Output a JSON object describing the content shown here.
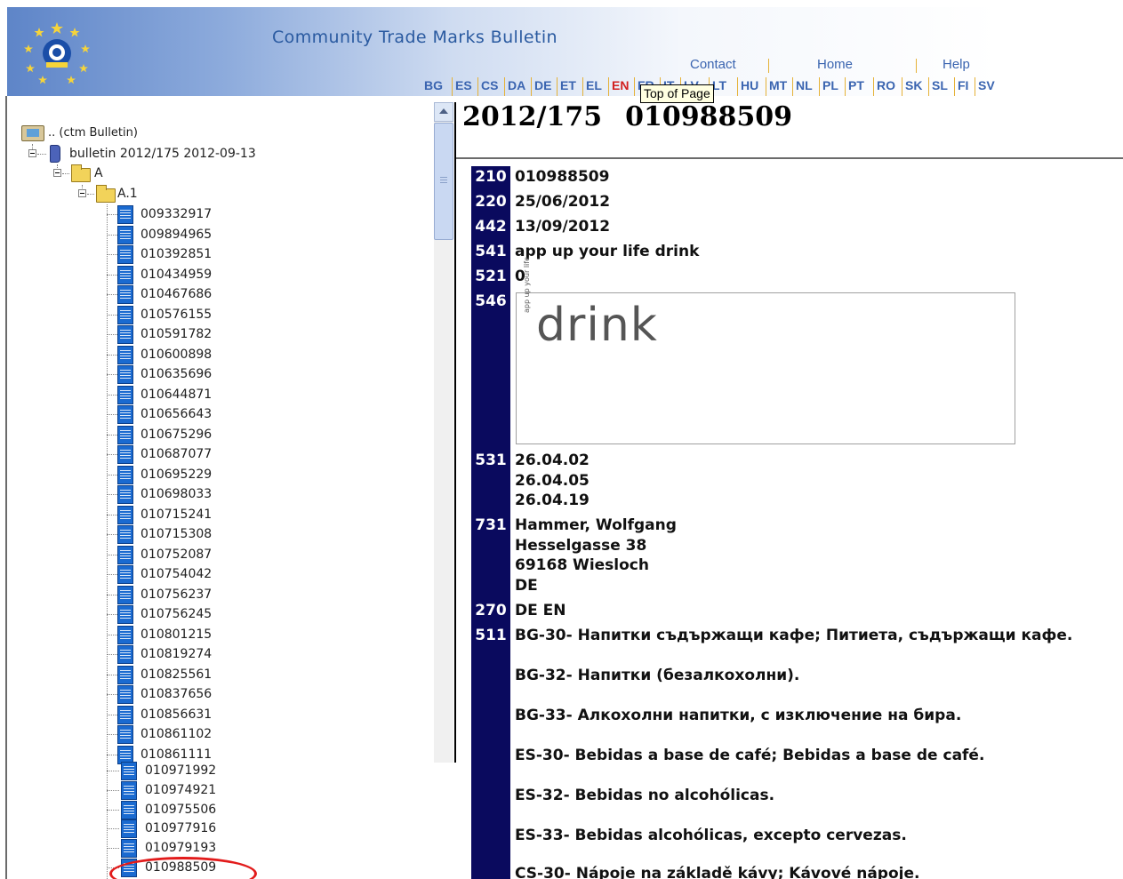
{
  "header": {
    "site_title": "Community Trade Marks Bulletin",
    "links": [
      "Contact",
      "Home",
      "Help"
    ],
    "languages": [
      "BG",
      "ES",
      "CS",
      "DA",
      "DE",
      "ET",
      "EL",
      "EN",
      "FR",
      "IT",
      "LV",
      "LT",
      "HU",
      "MT",
      "NL",
      "PL",
      "PT",
      "RO",
      "SK",
      "SL",
      "FI",
      "SV"
    ],
    "active_language": "EN",
    "tooltip": "Top of Page"
  },
  "tree": {
    "root_label": ".. (ctm Bulletin)",
    "bulletin_label": "bulletin 2012/175 2012-09-13",
    "folder_a": "A",
    "folder_a1": "A.1",
    "items": [
      "009332917",
      "009894965",
      "010392851",
      "010434959",
      "010467686",
      "010576155",
      "010591782",
      "010600898",
      "010635696",
      "010644871",
      "010656643",
      "010675296",
      "010687077",
      "010695229",
      "010698033",
      "010715241",
      "010715308",
      "010752087",
      "010754042",
      "010756237",
      "010756245",
      "010801215",
      "010819274",
      "010825561",
      "010837656",
      "010856631",
      "010861102",
      "010861111"
    ],
    "items_lower": [
      "010971992",
      "010974921",
      "010975506",
      "010977916",
      "010979193",
      "010988509"
    ],
    "highlighted_item": "010988509"
  },
  "record": {
    "issue": "2012/175",
    "number": "010988509",
    "f210": {
      "code": "210",
      "value": "010988509"
    },
    "f220": {
      "code": "220",
      "value": "25/06/2012"
    },
    "f442": {
      "code": "442",
      "value": "13/09/2012"
    },
    "f541": {
      "code": "541",
      "value": "app up your life drink"
    },
    "f521": {
      "code": "521",
      "value": "0"
    },
    "f546": {
      "code": "546",
      "mark_word": "drink",
      "mark_tag": "app up your life"
    },
    "f531": {
      "code": "531",
      "lines": [
        "26.04.02",
        "26.04.05",
        "26.04.19"
      ]
    },
    "f731": {
      "code": "731",
      "lines": [
        "Hammer, Wolfgang",
        "Hesselgasse 38",
        "69168 Wiesloch",
        "DE"
      ]
    },
    "f270": {
      "code": "270",
      "value": "DE EN"
    },
    "f511": {
      "code": "511",
      "lines": [
        "BG-30- Напитки съдържащи кафе; Питиета, съдържащи кафе.",
        "BG-32- Напитки (безалкохолни).",
        "BG-33- Алкохолни напитки, с изключение на бира.",
        "ES-30- Bebidas a base de café; Bebidas a base de café.",
        "ES-32- Bebidas no alcohólicas.",
        "ES-33- Bebidas alcohólicas, excepto cervezas.",
        "CS-30- Nápoje na základě kávy; Kávové nápoje."
      ]
    }
  }
}
